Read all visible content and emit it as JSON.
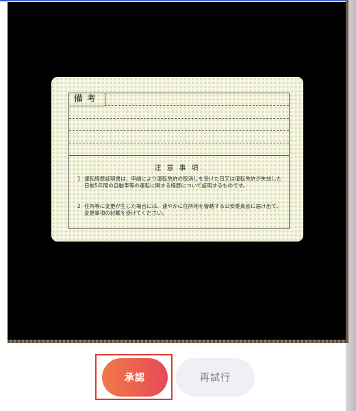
{
  "card": {
    "remarks_label": "備考",
    "notice_title": "注意事項",
    "notices": [
      {
        "num": "1",
        "text": "運転経歴証明書は、申請により運転免許の取消しを受けた日又は運転免許が失効した日前5年間の自動車等の運転に関する経歴について証明するものです。"
      },
      {
        "num": "2",
        "text": "住所等に変更が生じた場合には、速やかに住所地を管轄する公安委員会に届け出て、変更事項の記載を受けてください。"
      }
    ]
  },
  "buttons": {
    "approve_label": "承認",
    "retry_label": "再試行"
  }
}
